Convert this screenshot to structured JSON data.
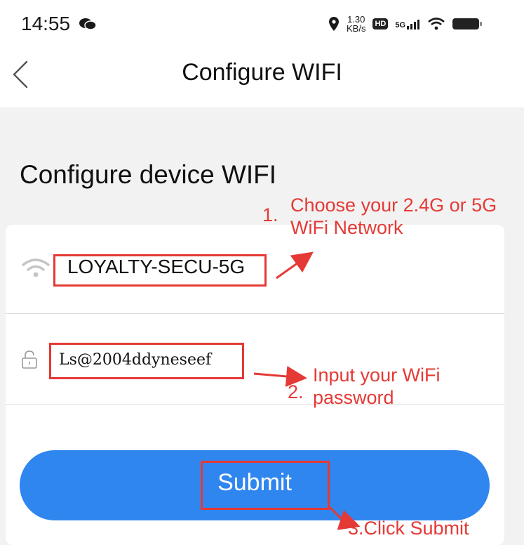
{
  "status_bar": {
    "time": "14:55",
    "speed_value": "1.30",
    "speed_unit": "KB/s",
    "hd_badge": "HD",
    "network_badge": "5G"
  },
  "header": {
    "title": "Configure WIFI"
  },
  "form": {
    "heading": "Configure device WIFI",
    "network_name": "LOYALTY-SECU-5G",
    "password_value": "Ls@2004ddyneseef",
    "submit_label": "Submit"
  },
  "annotations": {
    "step1_number": "1.",
    "step1_text": [
      "Choose your 2.4G or 5G",
      "WiFi Network"
    ],
    "step2_number": "2.",
    "step2_text": [
      "Input your WiFi",
      "password"
    ],
    "step3_text": "3.Click Submit",
    "color": "#e53935"
  },
  "colors": {
    "button": "#2f86ef",
    "background": "#f2f2f2",
    "card": "#ffffff"
  },
  "icons": [
    "chat-icon",
    "location-icon",
    "signal-icon",
    "wifi-status-icon",
    "battery-icon",
    "back-icon",
    "wifi-icon",
    "lock-icon"
  ]
}
